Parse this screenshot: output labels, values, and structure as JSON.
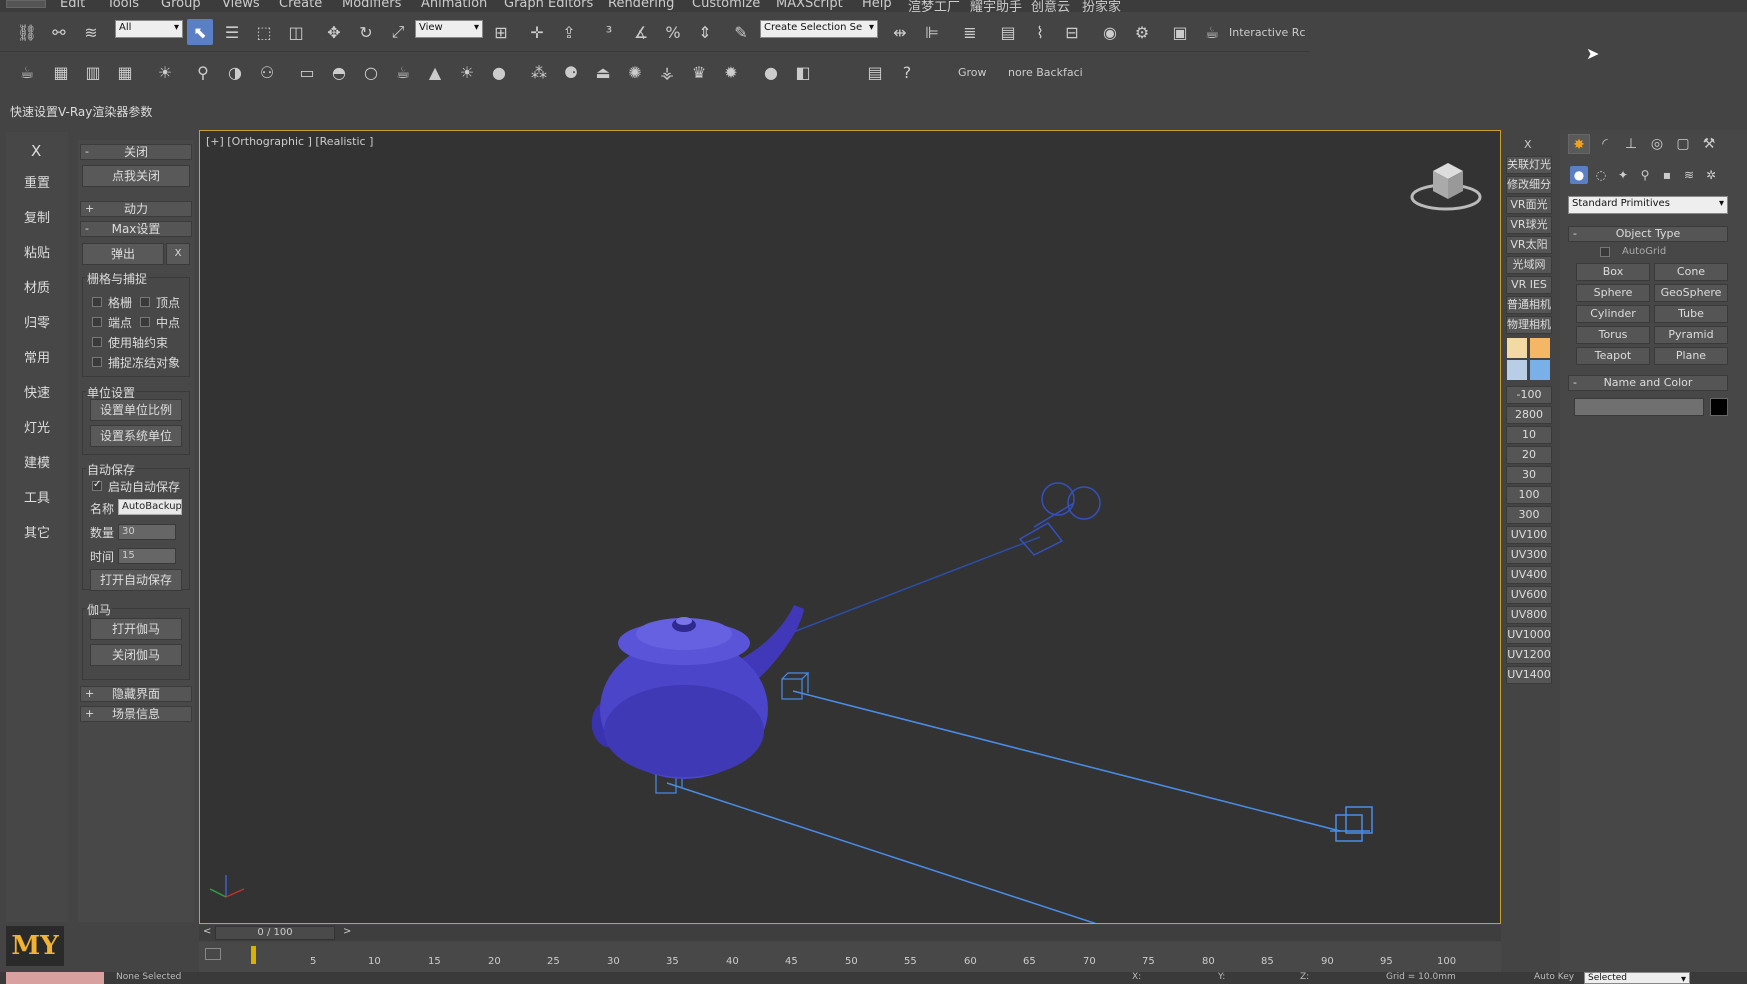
{
  "menubar": [
    "Edit",
    "Tools",
    "Group",
    "Views",
    "Create",
    "Modifiers",
    "Animation",
    "Graph Editors",
    "Rendering",
    "Customize",
    "MAXScript",
    "Help",
    "渲梦工厂",
    "耀宇助手",
    "创意云",
    "扮家家"
  ],
  "toolbar": {
    "selection_filter": "All",
    "ref_coord": "View",
    "selection_set": "Create Selection Se",
    "interactive": "Interactive Rc",
    "grow": "Grow",
    "backface": "nore Backfaci"
  },
  "vray_title": "快速设置V-Ray渲染器参数",
  "leftbar": {
    "close": "X",
    "items": [
      "重置",
      "复制",
      "粘贴",
      "材质",
      "归零",
      "常用",
      "快速",
      "灯光",
      "建模",
      "工具",
      "其它"
    ]
  },
  "panel": {
    "r1_sign": "-",
    "r1_title": "关闭",
    "close_btn": "点我关闭",
    "r2_sign": "+",
    "r2_title": "动力",
    "r3_sign": "-",
    "r3_title": "Max设置",
    "popout": "弹出",
    "popout_x": "X",
    "grid_group": "栅格与捕捉",
    "cb_grid": "格栅",
    "cb_vertex": "顶点",
    "cb_end": "端点",
    "cb_mid": "中点",
    "cb_axis": "使用轴约束",
    "cb_frozen": "捕捉冻结对象",
    "unit_group": "单位设置",
    "unit_scale": "设置单位比例",
    "sys_unit": "设置系统单位",
    "autosave_group": "自动保存",
    "cb_autosave": "启动自动保存",
    "name_label": "名称",
    "name_value": "AutoBackup",
    "count_label": "数量",
    "count_value": "30",
    "time_label": "时间",
    "time_value": "15",
    "open_autosave": "打开自动保存",
    "gamma_group": "伽马",
    "open_gamma": "打开伽马",
    "close_gamma": "关闭伽马",
    "r4_sign": "+",
    "r4_title": "隐藏界面",
    "r5_sign": "+",
    "r5_title": "场景信息"
  },
  "viewport": {
    "label": "[+] [Orthographic ] [Realistic ]"
  },
  "timeline": {
    "frame": "0 / 100",
    "prev": "<",
    "next": ">"
  },
  "ticks": [
    "5",
    "10",
    "15",
    "20",
    "25",
    "30",
    "35",
    "40",
    "45",
    "50",
    "55",
    "60",
    "65",
    "70",
    "75",
    "80",
    "85",
    "90",
    "95",
    "100"
  ],
  "midcol": {
    "close": "X",
    "buttons": [
      "关联灯光",
      "修改细分",
      "VR面光",
      "VR球光",
      "VR太阳",
      "光域网",
      "VR IES",
      "普通相机",
      "物理相机"
    ],
    "swatches": [
      "#f3d9a4",
      "#f4b766",
      "#b8cde6",
      "#7ab0e8"
    ],
    "values": [
      "-100",
      "2800",
      "10",
      "20",
      "30",
      "100",
      "300",
      "UV100",
      "UV300",
      "UV400",
      "UV600",
      "UV800",
      "UV1000",
      "UV1200",
      "UV1400"
    ]
  },
  "cmdpanel": {
    "category": "Standard Primitives",
    "object_type_sign": "-",
    "object_type": "Object Type",
    "autogrid": "AutoGrid",
    "prims": [
      "Box",
      "Cone",
      "Sphere",
      "GeoSphere",
      "Cylinder",
      "Tube",
      "Torus",
      "Pyramid",
      "Teapot",
      "Plane"
    ],
    "name_color_sign": "-",
    "name_color": "Name and Color"
  },
  "status": {
    "selected": "None Selected",
    "grid": "Grid = 10.0mm",
    "autokey": "Auto Key",
    "keymode": "Selected",
    "x": "X:",
    "y": "Y:",
    "z": "Z:"
  },
  "colors": {
    "viewport_border": "#c8a030",
    "teapot": "#4b45c9",
    "light": "#3a6bd8",
    "accent": "#5a7fc4"
  }
}
